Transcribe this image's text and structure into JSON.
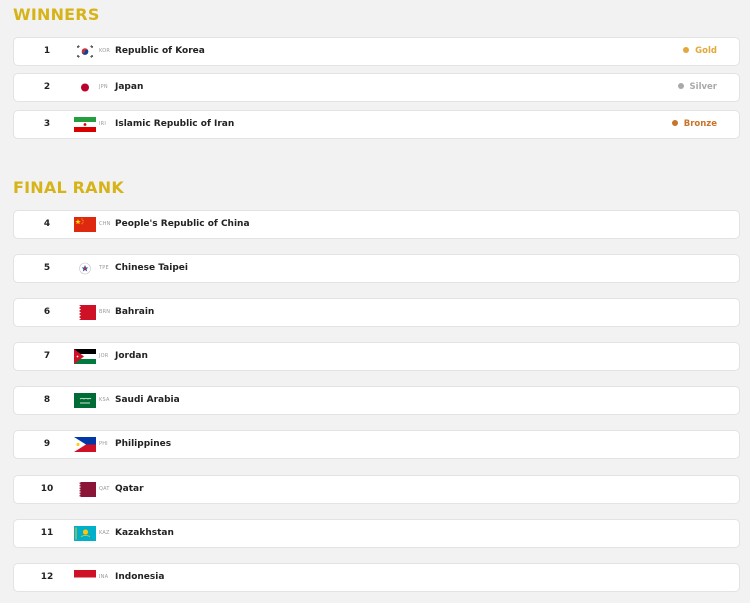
{
  "winners": {
    "title": "WINNERS",
    "rows": [
      {
        "rank": "1",
        "code": "KOR",
        "country": "Republic of Korea",
        "medal": "Gold",
        "medal_color": "#e3a73b",
        "flag": "korea-flag-icon"
      },
      {
        "rank": "2",
        "code": "JPN",
        "country": "Japan",
        "medal": "Silver",
        "medal_color": "#a9a9a9",
        "flag": "japan-flag-icon"
      },
      {
        "rank": "3",
        "code": "IRI",
        "country": "Islamic Republic of Iran",
        "medal": "Bronze",
        "medal_color": "#c8742c",
        "flag": "iran-flag-icon"
      }
    ]
  },
  "final_rank": {
    "title": "FINAL RANK",
    "rows": [
      {
        "rank": "4",
        "code": "CHN",
        "country": "People's Republic of China",
        "flag": "china-flag-icon"
      },
      {
        "rank": "5",
        "code": "TPE",
        "country": "Chinese Taipei",
        "flag": "chinese-taipei-flag-icon"
      },
      {
        "rank": "6",
        "code": "BRN",
        "country": "Bahrain",
        "flag": "bahrain-flag-icon"
      },
      {
        "rank": "7",
        "code": "JOR",
        "country": "Jordan",
        "flag": "jordan-flag-icon"
      },
      {
        "rank": "8",
        "code": "KSA",
        "country": "Saudi Arabia",
        "flag": "saudi-arabia-flag-icon"
      },
      {
        "rank": "9",
        "code": "PHI",
        "country": "Philippines",
        "flag": "philippines-flag-icon"
      },
      {
        "rank": "10",
        "code": "QAT",
        "country": "Qatar",
        "flag": "qatar-flag-icon"
      },
      {
        "rank": "11",
        "code": "KAZ",
        "country": "Kazakhstan",
        "flag": "kazakhstan-flag-icon"
      },
      {
        "rank": "12",
        "code": "INA",
        "country": "Indonesia",
        "flag": "indonesia-flag-icon"
      }
    ]
  },
  "colors": {
    "section_title": "#d6b419",
    "row_background": "#ffffff",
    "page_background": "#f2f2f2"
  }
}
